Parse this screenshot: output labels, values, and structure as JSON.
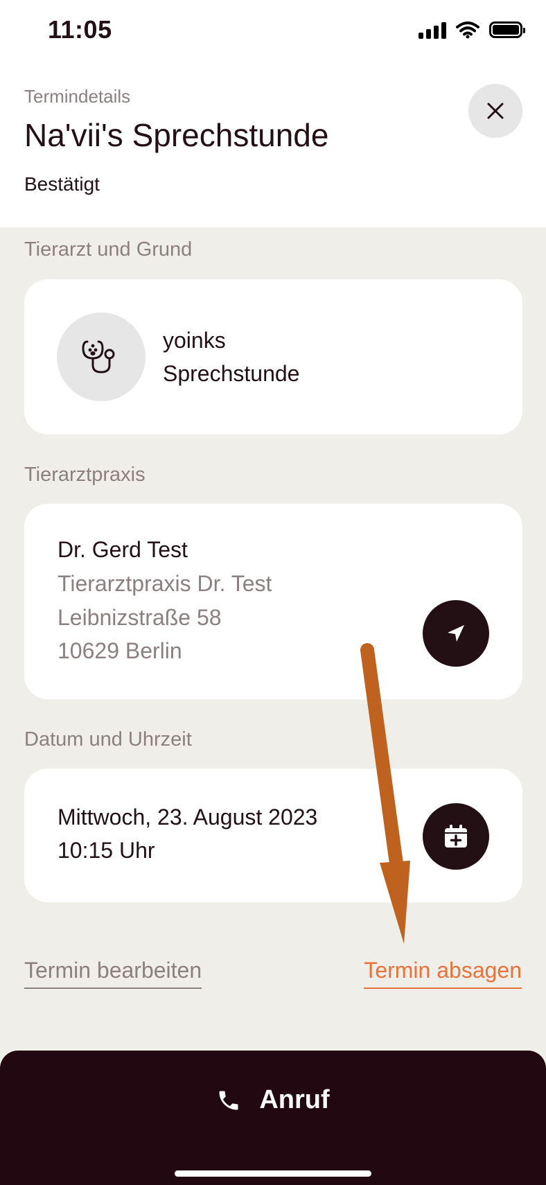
{
  "status_bar": {
    "time": "11:05"
  },
  "header": {
    "eyebrow": "Termindetails",
    "title": "Na'vii's Sprechstunde",
    "status": "Bestätigt"
  },
  "sections": {
    "vet_reason": {
      "label": "Tierarzt und Grund",
      "vet_name": "yoinks",
      "reason": "Sprechstunde"
    },
    "practice": {
      "label": "Tierarztpraxis",
      "doctor": "Dr. Gerd Test",
      "practice_name": "Tierarztpraxis Dr. Test",
      "street": "Leibnizstraße 58",
      "city": "10629 Berlin"
    },
    "datetime": {
      "label": "Datum und Uhrzeit",
      "date": "Mittwoch, 23. August 2023",
      "time": "10:15 Uhr"
    }
  },
  "actions": {
    "edit_label": "Termin bearbeiten",
    "cancel_label": "Termin absagen"
  },
  "call": {
    "label": "Anruf"
  },
  "icons": {
    "close": "close-icon",
    "stethoscope": "stethoscope-icon",
    "navigate": "navigation-arrow-icon",
    "calendar_add": "calendar-add-icon",
    "phone": "phone-icon"
  },
  "colors": {
    "background": "#f0eee8",
    "card": "#ffffff",
    "dark": "#231015",
    "muted": "#8b7f80",
    "accent": "#e8733a",
    "annotation_arrow": "#c0621f"
  }
}
